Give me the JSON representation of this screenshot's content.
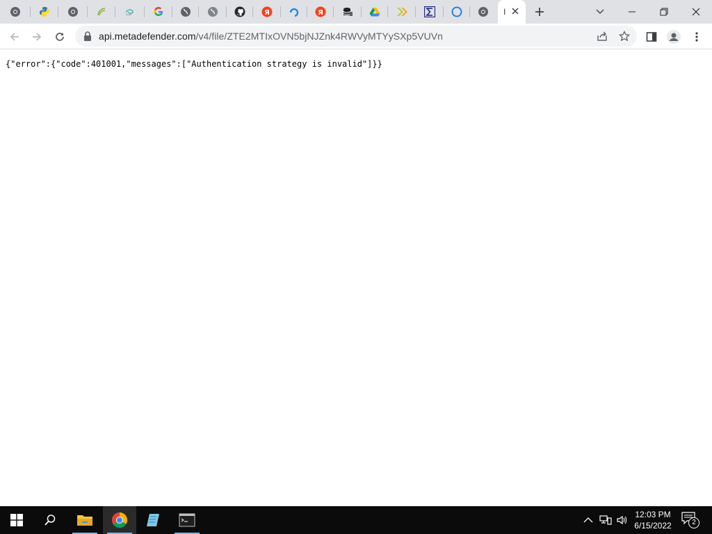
{
  "browser": {
    "tabs": [
      {
        "icon": "chrome-icon"
      },
      {
        "icon": "python-icon"
      },
      {
        "icon": "chrome-icon"
      },
      {
        "icon": "leaf-icon"
      },
      {
        "icon": "swirl-icon"
      },
      {
        "icon": "google-icon"
      },
      {
        "icon": "globe-icon"
      },
      {
        "icon": "globe-icon"
      },
      {
        "icon": "github-icon"
      },
      {
        "icon": "yandex-icon"
      },
      {
        "icon": "blue-arc-icon"
      },
      {
        "icon": "yandex-icon"
      },
      {
        "icon": "database-icon"
      },
      {
        "icon": "google-drive-icon"
      },
      {
        "icon": "double-chevron-icon"
      },
      {
        "icon": "sigma-icon"
      },
      {
        "icon": "circle-icon"
      },
      {
        "icon": "chrome-icon"
      }
    ],
    "active_tab": {
      "title": "I"
    },
    "url_host": "api.metadefender.com",
    "url_path": "/v4/file/ZTE2MTIxOVN5bjNJZnk4RWVyMTYySXp5VUVn"
  },
  "page": {
    "body_text": "{\"error\":{\"code\":401001,\"messages\":[\"Authentication strategy is invalid\"]}}"
  },
  "taskbar": {
    "time": "12:03 PM",
    "date": "6/15/2022",
    "notification_count": "2"
  },
  "colors": {
    "tabstrip": "#dfe1e5",
    "taskbar": "#0b0b0b",
    "accent": "#1a73e8"
  }
}
